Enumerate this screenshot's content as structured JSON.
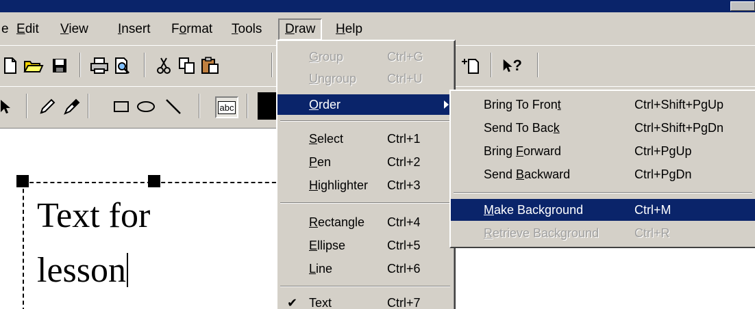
{
  "menubar": {
    "items": [
      {
        "label": "e",
        "u": ""
      },
      {
        "label": "Edit",
        "u": "E"
      },
      {
        "label": "View",
        "u": "V"
      },
      {
        "label": "Insert",
        "u": "I"
      },
      {
        "label": "Format",
        "u": "o"
      },
      {
        "label": "Tools",
        "u": "T"
      },
      {
        "label": "Draw",
        "u": "D"
      },
      {
        "label": "Help",
        "u": "H"
      }
    ]
  },
  "toolbar1": {
    "icons": [
      "new-document-icon",
      "open-folder-icon",
      "save-icon",
      "print-icon",
      "print-preview-icon",
      "cut-icon",
      "copy-icon",
      "paste-icon",
      "new-page-icon",
      "whats-this-help-icon"
    ],
    "help_glyph": "?"
  },
  "toolbar2": {
    "icons": [
      "pointer-icon",
      "pen-icon",
      "highlighter-icon",
      "rectangle-icon",
      "ellipse-icon",
      "line-icon",
      "text-tool-icon",
      "color-swatch"
    ],
    "text_tool_label": "abc",
    "swatch_color": "#000000"
  },
  "document": {
    "line1": "Text for",
    "line2": "lesson"
  },
  "draw_menu": {
    "items": [
      {
        "pre": "",
        "u": "G",
        "post": "roup",
        "shortcut": "Ctrl+G",
        "disabled": true
      },
      {
        "pre": "",
        "u": "U",
        "post": "ngroup",
        "shortcut": "Ctrl+U",
        "disabled": true
      },
      {
        "pre": "",
        "u": "O",
        "post": "rder",
        "shortcut": "",
        "highlight": true
      },
      {
        "pre": "",
        "u": "S",
        "post": "elect",
        "shortcut": "Ctrl+1"
      },
      {
        "pre": "",
        "u": "P",
        "post": "en",
        "shortcut": "Ctrl+2"
      },
      {
        "pre": "",
        "u": "H",
        "post": "ighlighter",
        "shortcut": "Ctrl+3"
      },
      {
        "pre": "",
        "u": "R",
        "post": "ectangle",
        "shortcut": "Ctrl+4"
      },
      {
        "pre": "",
        "u": "E",
        "post": "llipse",
        "shortcut": "Ctrl+5"
      },
      {
        "pre": "",
        "u": "L",
        "post": "ine",
        "shortcut": "Ctrl+6"
      },
      {
        "pre": "",
        "u": "",
        "post": "Text",
        "shortcut": "Ctrl+7",
        "checked": true
      }
    ],
    "check_glyph": "✔"
  },
  "order_submenu": {
    "items": [
      {
        "pre": "Bring To Fron",
        "u": "t",
        "post": "",
        "shortcut": "Ctrl+Shift+PgUp"
      },
      {
        "pre": "Send To Bac",
        "u": "k",
        "post": "",
        "shortcut": "Ctrl+Shift+PgDn"
      },
      {
        "pre": "Bring ",
        "u": "F",
        "post": "orward",
        "shortcut": "Ctrl+PgUp"
      },
      {
        "pre": "Send ",
        "u": "B",
        "post": "ackward",
        "shortcut": "Ctrl+PgDn"
      },
      {
        "pre": "",
        "u": "M",
        "post": "ake Background",
        "shortcut": "Ctrl+M",
        "highlight": true
      },
      {
        "pre": "",
        "u": "R",
        "post": "etrieve Background",
        "shortcut": "Ctrl+R",
        "disabled": true
      }
    ]
  },
  "colors": {
    "menu_bg": "#d4d0c8",
    "highlight": "#0a246a",
    "title_bar": "#0a246a"
  }
}
